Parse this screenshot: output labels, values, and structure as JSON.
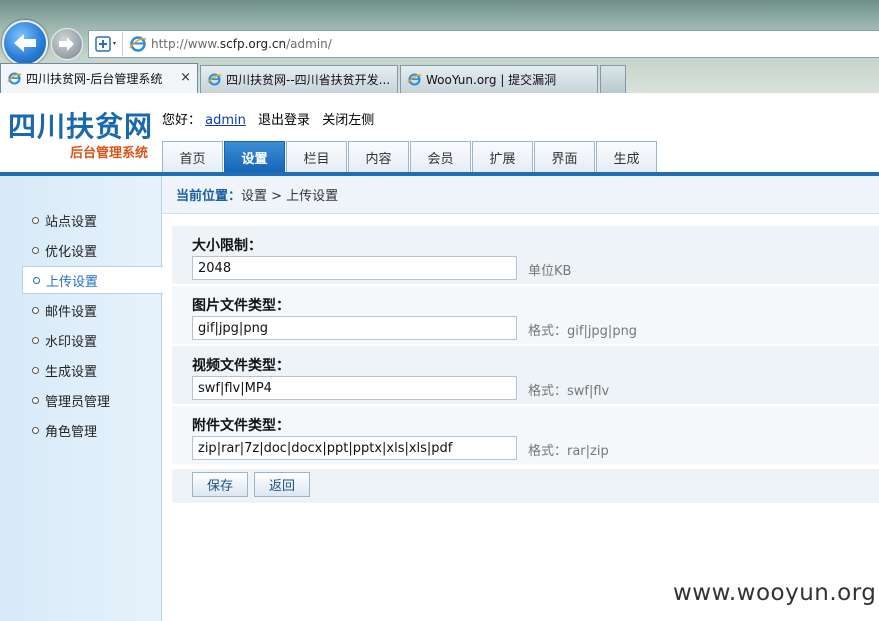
{
  "browser": {
    "url_prefix": "http://www.",
    "url_domain": "scfp.org.cn",
    "url_suffix": "/admin/",
    "tabs": [
      {
        "title": "四川扶贫网-后台管理系统",
        "close": "×"
      },
      {
        "title": "四川扶贫网--四川省扶贫开发..."
      },
      {
        "title": "WooYun.org | 提交漏洞"
      }
    ]
  },
  "header": {
    "logo_title": "四川扶贫网",
    "logo_subtitle": "后台管理系统",
    "greeting": "您好：",
    "username": "admin",
    "logout": "退出登录",
    "close_left": "关闭左侧"
  },
  "topnav": [
    "首页",
    "设置",
    "栏目",
    "内容",
    "会员",
    "扩展",
    "界面",
    "生成"
  ],
  "sidebar": [
    "站点设置",
    "优化设置",
    "上传设置",
    "邮件设置",
    "水印设置",
    "生成设置",
    "管理员管理",
    "角色管理"
  ],
  "breadcrumb": {
    "label": "当前位置：",
    "path": "设置 > 上传设置"
  },
  "form": {
    "fields": [
      {
        "label": "大小限制：",
        "value": "2048",
        "hint": "单位KB"
      },
      {
        "label": "图片文件类型：",
        "value": "gif|jpg|png",
        "hint": "格式：gif|jpg|png"
      },
      {
        "label": "视频文件类型：",
        "value": "swf|flv|MP4",
        "hint": "格式：swf|flv"
      },
      {
        "label": "附件文件类型：",
        "value": "zip|rar|7z|doc|docx|ppt|pptx|xls|xls|pdf",
        "hint": "格式：rar|zip"
      }
    ],
    "save_label": "保存",
    "back_label": "返回"
  },
  "watermark": "www.wooyun.org",
  "colors": {
    "accent": "#1e6fb8",
    "nav_active": "#1565b5",
    "logo_sub": "#d9541a"
  }
}
